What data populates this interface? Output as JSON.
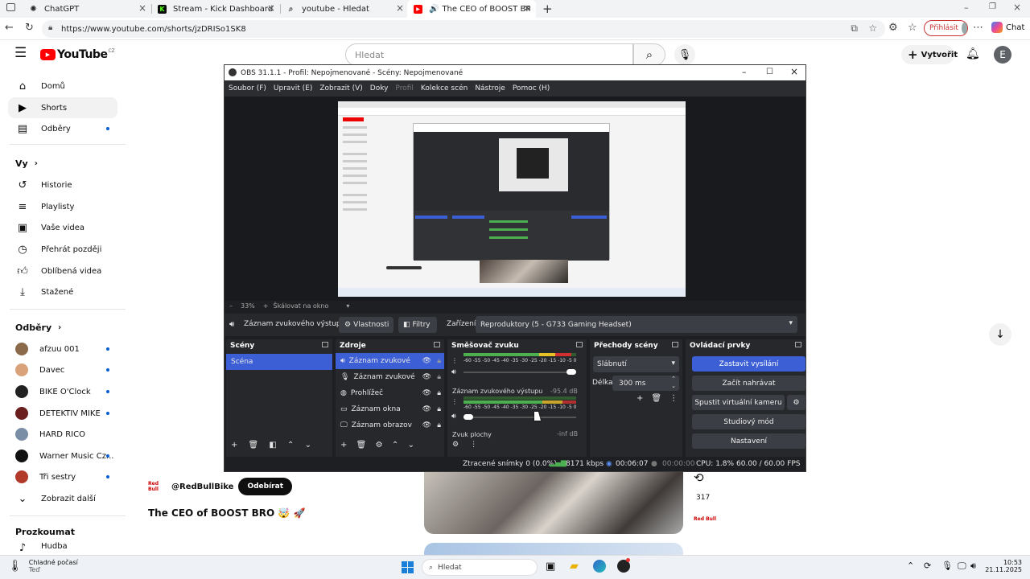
{
  "browser": {
    "tabs": [
      {
        "title": "ChatGPT",
        "icon": "chatgpt-icon",
        "active": false
      },
      {
        "title": "Stream - Kick Dashboard",
        "icon": "kick-icon",
        "active": false
      },
      {
        "title": "youtube - Hledat",
        "icon": "search-icon",
        "active": false
      },
      {
        "title": "The CEO of BOOST BRO 🤯 🚀",
        "icon": "youtube-icon",
        "active": true
      }
    ],
    "url": "https://www.youtube.com/shorts/jzDRISo1SK8",
    "sign_in_label": "Přihlásit",
    "chat_label": "Chat"
  },
  "youtube": {
    "logo_text": "YouTube",
    "logo_region": "CZ",
    "search_placeholder": "Hledat",
    "create_label": "Vytvořit",
    "avatar_letter": "E",
    "nav_main": [
      {
        "label": "Domů",
        "icon": "home-icon"
      },
      {
        "label": "Shorts",
        "icon": "shorts-icon",
        "selected": true
      },
      {
        "label": "Odběry",
        "icon": "subscriptions-icon",
        "dot": true
      }
    ],
    "you_heading": "Vy",
    "nav_you": [
      {
        "label": "Historie",
        "icon": "history-icon"
      },
      {
        "label": "Playlisty",
        "icon": "playlists-icon"
      },
      {
        "label": "Vaše videa",
        "icon": "your-videos-icon"
      },
      {
        "label": "Přehrát později",
        "icon": "watch-later-icon"
      },
      {
        "label": "Oblíbená videa",
        "icon": "liked-icon"
      },
      {
        "label": "Stažené",
        "icon": "download-icon"
      }
    ],
    "subs_heading": "Odběry",
    "subscriptions": [
      {
        "label": "afzuu 001",
        "color": "#8a6a4a"
      },
      {
        "label": "Davec",
        "color": "#d9a27a"
      },
      {
        "label": "BIKE O'Clock",
        "color": "#222222"
      },
      {
        "label": "DETEKTIV MIKE",
        "color": "#6b1f1f"
      },
      {
        "label": "HARD RICO",
        "color": "#7a8ea6"
      },
      {
        "label": "Warner Music Cz...",
        "color": "#111111"
      },
      {
        "label": "Tři sestry",
        "color": "#b23a2a"
      }
    ],
    "show_more_label": "Zobrazit další",
    "explore_heading": "Prozkoumat",
    "explore_first": "Hudba",
    "short": {
      "channel": "@RedBullBike",
      "subscribe_label": "Odebírat",
      "title": "The CEO of BOOST BRO 🤯 🚀",
      "remix_count": "317"
    }
  },
  "obs": {
    "title": "OBS 31.1.1 - Profil: Nepojmenované - Scény: Nepojmenované",
    "menu": [
      "Soubor (F)",
      "Upravit (E)",
      "Zobrazit (V)",
      "Doky",
      "Profil",
      "Kolekce scén",
      "Nástroje",
      "Pomoc (H)"
    ],
    "zoom": "33%",
    "scale_label": "Škálovat na okno",
    "selected_source": "Záznam zvukového výstup",
    "properties_label": "Vlastnosti",
    "filters_label": "Filtry",
    "device_label": "Zařízení",
    "device_value": "Reproduktory (5 - G733 Gaming Headset)",
    "scenes_title": "Scény",
    "scenes": [
      "Scéna"
    ],
    "sources_title": "Zdroje",
    "sources": [
      {
        "label": "Záznam zvukové",
        "icon": "speaker-icon"
      },
      {
        "label": "Záznam zvukové",
        "icon": "microphone-icon"
      },
      {
        "label": "Prohlížeč",
        "icon": "globe-icon"
      },
      {
        "label": "Záznam okna",
        "icon": "window-icon"
      },
      {
        "label": "Záznam obrazov",
        "icon": "monitor-icon"
      }
    ],
    "mixer_title": "Směšovač zvuku",
    "mixer_scale": "-60 -55 -50 -45 -40 -35 -30 -25 -20 -15 -10 -5 0",
    "mixer_channels": [
      {
        "label": "",
        "db": "",
        "level": 0.96
      },
      {
        "label": "Záznam zvukového výstupu",
        "db": "-95.4 dB",
        "level": 0.06
      },
      {
        "label": "Zvuk plochy",
        "db": "-inf dB",
        "level": 0
      }
    ],
    "transitions_title": "Přechody scény",
    "transition_value": "Slábnutí",
    "duration_label": "Délka",
    "duration_value": "300 ms",
    "controls_title": "Ovládací prvky",
    "controls": [
      "Zastavit vysílání",
      "Začít nahrávat",
      "Spustit virtuální kameru",
      "Studiový mód",
      "Nastavení"
    ],
    "status": {
      "dropped": "Ztracené snímky 0 (0.0%)",
      "bitrate": "8171 kbps",
      "stream_time": "00:06:07",
      "rec_time": "00:00:00",
      "cpu": "CPU: 1.8%",
      "fps": "60.00 / 60.00 FPS"
    }
  },
  "taskbar": {
    "weather": "Chladné počasí",
    "weather_sub": "Teď",
    "search_placeholder": "Hledat",
    "time": "10:53",
    "date": "21.11.2025"
  }
}
